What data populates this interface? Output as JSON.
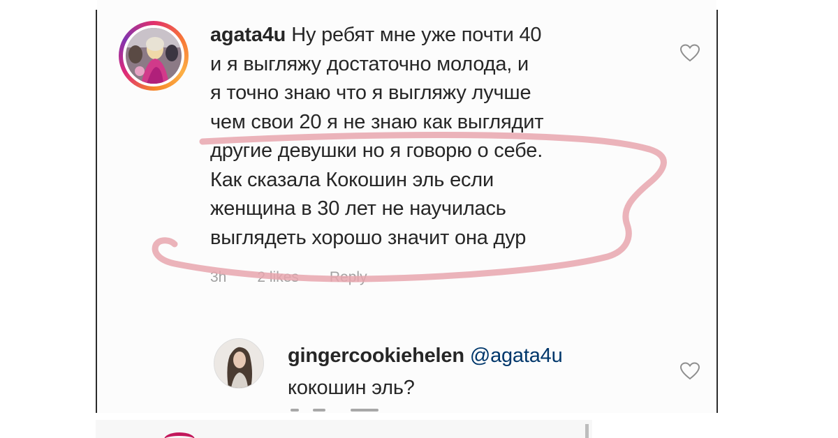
{
  "comment": {
    "username": "agata4u",
    "lines": [
      "Ну ребят мне уже почти 40",
      "и я выгляжу достаточно молода, и",
      "я точно знаю что я выгляжу лучше",
      "чем свои 20 я не знаю как выглядит",
      "другие девушки но я говорю о себе.",
      "Как сказала Кокошин эль если",
      "женщина в 30 лет не научилась",
      "выглядеть хорошо значит она дур"
    ],
    "time": "3h",
    "likes": "2 likes",
    "reply_label": "Reply",
    "like_icon": "heart-outline-icon",
    "avatar_icon": "profile-photo-with-story-ring"
  },
  "reply": {
    "username": "gingercookiehelen",
    "mention": "@agata4u",
    "text": "кокошин эль?",
    "like_icon": "heart-outline-icon",
    "avatar_icon": "profile-photo"
  },
  "colors": {
    "text": "#262626",
    "meta": "#a0a0a0",
    "mention": "#00376b",
    "annotation": "#e8a6ae",
    "story_ring": "#e1306c"
  }
}
